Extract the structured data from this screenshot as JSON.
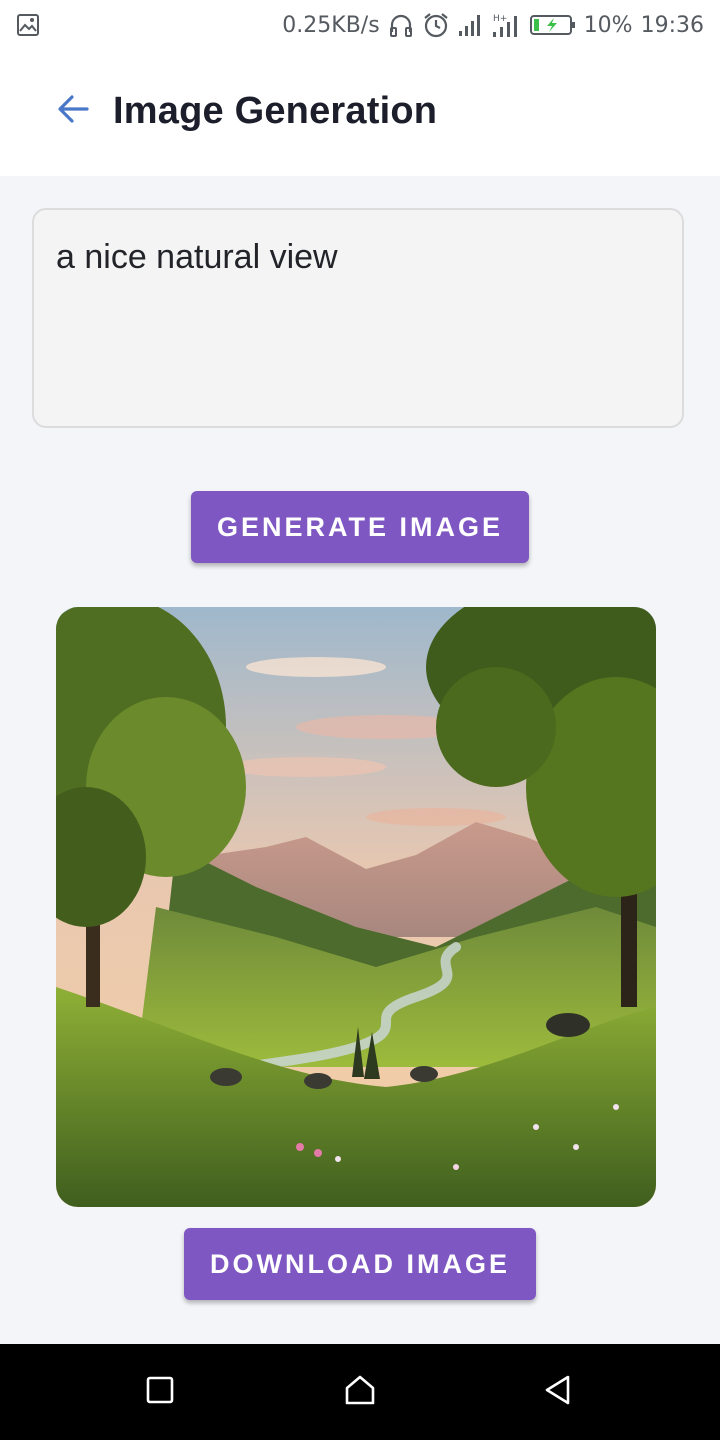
{
  "status_bar": {
    "speed": "0.25KB/s",
    "battery": "10%",
    "time": "19:36",
    "icons": [
      "image-icon",
      "headset-icon",
      "alarm-icon",
      "signal-icon",
      "signal-hplus-icon",
      "battery-charging-icon"
    ]
  },
  "app_bar": {
    "title": "Image Generation",
    "back_icon": "arrow-left-icon"
  },
  "prompt": {
    "value": "a nice natural view"
  },
  "buttons": {
    "generate_label": "GENERATE IMAGE",
    "download_label": "DOWNLOAD IMAGE"
  },
  "nav_bar": {
    "icons": [
      "recents-square-icon",
      "home-icon",
      "back-triangle-icon"
    ]
  },
  "colors": {
    "accent": "#7e57c2",
    "back_arrow": "#4a78c8",
    "background": "#f3f5f9"
  }
}
